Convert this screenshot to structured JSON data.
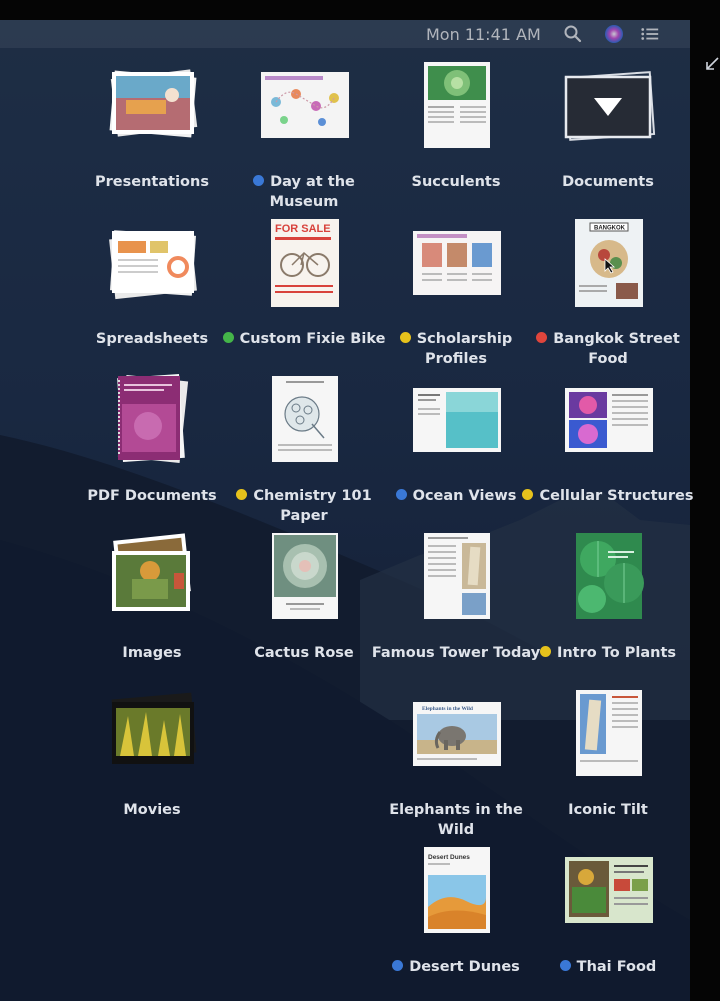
{
  "menubar": {
    "clock": "Mon 11:41 AM",
    "icons": [
      "search-icon",
      "siri-icon",
      "notification-center-icon"
    ]
  },
  "tag_colors": {
    "blue": "#3a78d6",
    "green": "#44b549",
    "yellow": "#e6c21c",
    "red": "#e0453c"
  },
  "items": [
    {
      "id": "presentations",
      "label": "Presentations",
      "tag": null,
      "thumb": "stack-presentations"
    },
    {
      "id": "day-at-the-museum",
      "label": "Day at the Museum",
      "tag": "blue",
      "thumb": "doc-landscape-museum"
    },
    {
      "id": "succulents",
      "label": "Succulents",
      "tag": null,
      "thumb": "doc-portrait-succulents"
    },
    {
      "id": "documents",
      "label": "Documents",
      "tag": null,
      "thumb": "stack-documents"
    },
    {
      "id": "spreadsheets",
      "label": "Spreadsheets",
      "tag": null,
      "thumb": "stack-spreadsheets"
    },
    {
      "id": "custom-fixie-bike",
      "label": "Custom Fixie Bike",
      "tag": "green",
      "thumb": "doc-portrait-forsale",
      "thumb_text": "FOR SALE"
    },
    {
      "id": "scholarship-profiles",
      "label": "Scholarship Profiles",
      "tag": "yellow",
      "thumb": "doc-landscape-profiles"
    },
    {
      "id": "bangkok-street-food",
      "label": "Bangkok Street Food",
      "tag": "red",
      "thumb": "doc-portrait-bangkok",
      "thumb_text": "BANGKOK"
    },
    {
      "id": "pdf-documents",
      "label": "PDF Documents",
      "tag": null,
      "thumb": "stack-pdf"
    },
    {
      "id": "chemistry-101-paper",
      "label": "Chemistry 101 Paper",
      "tag": "yellow",
      "thumb": "doc-portrait-chemistry"
    },
    {
      "id": "ocean-views",
      "label": "Ocean Views",
      "tag": "blue",
      "thumb": "doc-landscape-ocean"
    },
    {
      "id": "cellular-structures",
      "label": "Cellular Structures",
      "tag": "yellow",
      "thumb": "doc-landscape-cells"
    },
    {
      "id": "images",
      "label": "Images",
      "tag": null,
      "thumb": "stack-images"
    },
    {
      "id": "cactus-rose",
      "label": "Cactus Rose",
      "tag": null,
      "thumb": "doc-portrait-cactus"
    },
    {
      "id": "famous-tower-today",
      "label": "Famous Tower Today",
      "tag": null,
      "thumb": "doc-portrait-tower"
    },
    {
      "id": "intro-to-plants",
      "label": "Intro To Plants",
      "tag": "yellow",
      "thumb": "doc-portrait-plants"
    },
    {
      "id": "movies",
      "label": "Movies",
      "tag": null,
      "thumb": "stack-movies"
    },
    {
      "id": "elephants-in-the-wild",
      "label": "Elephants in the Wild",
      "tag": null,
      "thumb": "doc-landscape-elephants",
      "thumb_text": "Elephants in the Wild"
    },
    {
      "id": "iconic-tilt",
      "label": "Iconic Tilt",
      "tag": null,
      "thumb": "doc-portrait-iconic"
    },
    {
      "id": "desert-dunes",
      "label": "Desert Dunes",
      "tag": "blue",
      "thumb": "doc-portrait-desert",
      "thumb_text": "Desert Dunes"
    },
    {
      "id": "thai-food",
      "label": "Thai Food",
      "tag": "blue",
      "thumb": "doc-landscape-thai"
    }
  ]
}
